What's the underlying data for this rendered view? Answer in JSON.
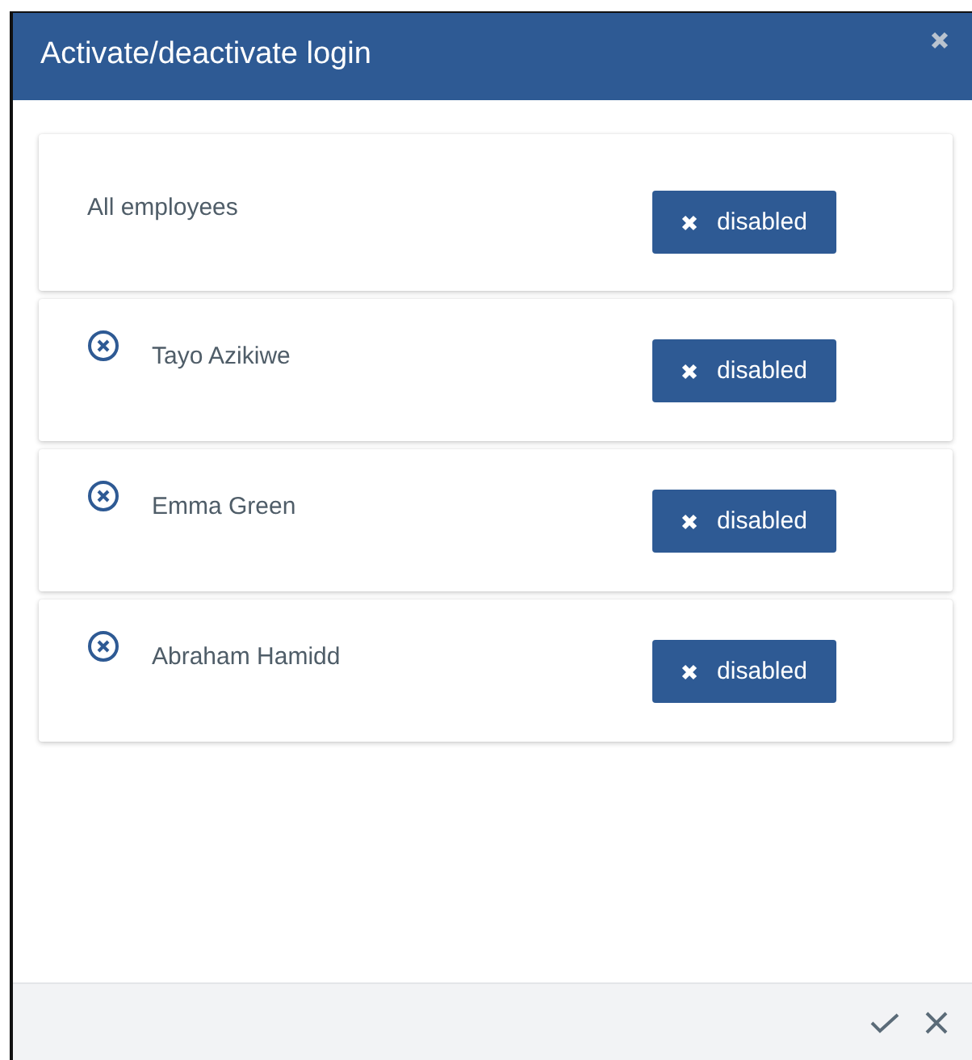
{
  "window": {
    "title": "Activate/deactivate login"
  },
  "rows": [
    {
      "kind": "all",
      "name": "All employees",
      "button": "disabled"
    },
    {
      "kind": "person",
      "name": "Tayo Azikiwe",
      "button": "disabled"
    },
    {
      "kind": "person",
      "name": "Emma Green",
      "button": "disabled"
    },
    {
      "kind": "person",
      "name": "Abraham Hamidd",
      "button": "disabled"
    }
  ]
}
